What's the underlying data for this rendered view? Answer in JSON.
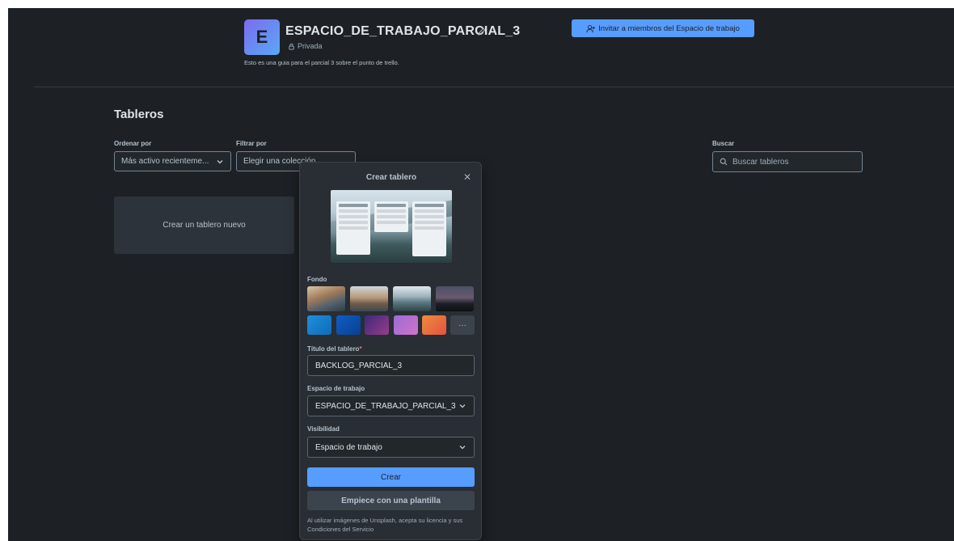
{
  "workspace": {
    "initial": "E",
    "name": "ESPACIO_DE_TRABAJO_PARCIAL_3",
    "privacy": "Privada",
    "description": "Esto es una guia para el parcial 3 sobre el punto de trello.",
    "invite_label": "Invitar a miembros del Espacio de trabajo"
  },
  "boards": {
    "title": "Tableros",
    "sort_label": "Ordenar por",
    "sort_value": "Más activo recienteme...",
    "filter_label": "Filtrar por",
    "filter_value": "Elegir una colección",
    "search_label": "Buscar",
    "search_placeholder": "Buscar tableros",
    "new_board_label": "Crear un tablero nuevo"
  },
  "create_board": {
    "title": "Crear tablero",
    "background_label": "Fondo",
    "more_label": "···",
    "board_title_label": "Título del tablero",
    "required_mark": "*",
    "board_title_value": "BACKLOG_PARCIAL_3",
    "workspace_label": "Espacio de trabajo",
    "workspace_value": "ESPACIO_DE_TRABAJO_PARCIAL_3",
    "visibility_label": "Visibilidad",
    "visibility_value": "Espacio de trabajo",
    "create_button": "Crear",
    "template_button": "Empiece con una plantilla",
    "legal_text": "Al utilizar imágenes de Unsplash, acepta su licencia y sus Condiciones del Servicio"
  },
  "colors": {
    "accent": "#579dff",
    "background": "#1d2125",
    "popover": "#282e33",
    "swatches": [
      "#1f8fdc",
      "#0c5ec8",
      "#6a2a8a",
      "#b16bd6",
      "#e3633f"
    ]
  }
}
